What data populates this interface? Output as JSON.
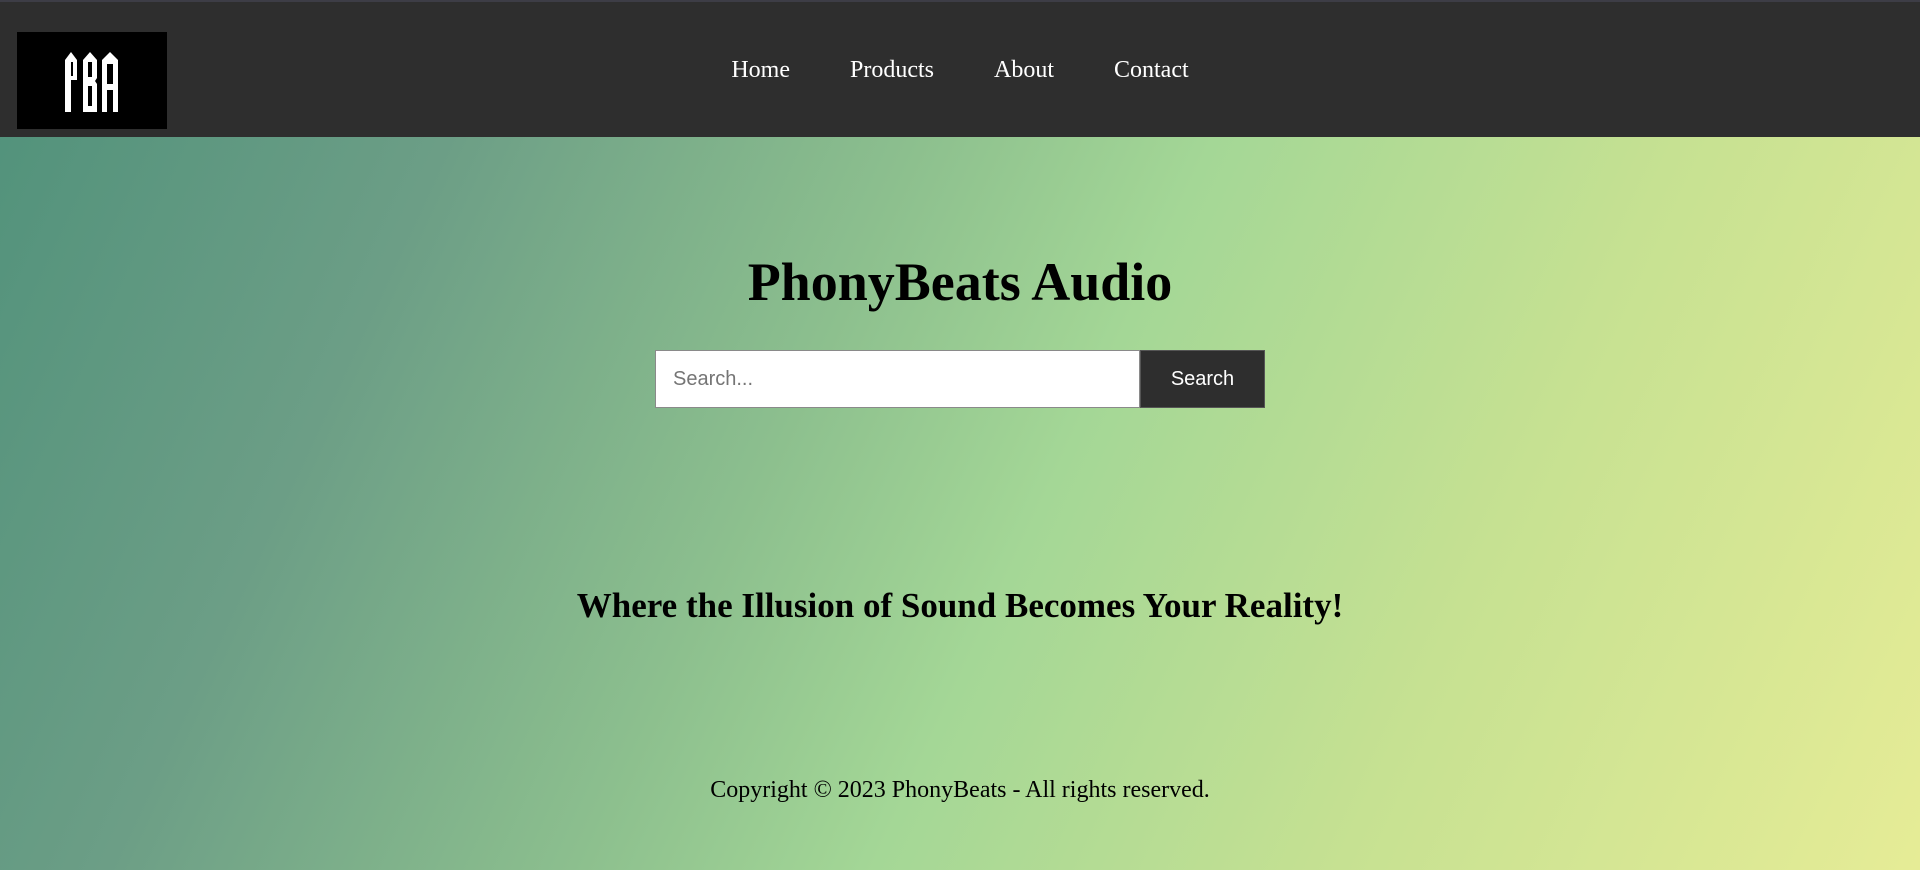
{
  "header": {
    "logo_text": "PBA",
    "nav": [
      {
        "label": "Home"
      },
      {
        "label": "Products"
      },
      {
        "label": "About"
      },
      {
        "label": "Contact"
      }
    ]
  },
  "hero": {
    "title": "PhonyBeats Audio",
    "search": {
      "placeholder": "Search...",
      "value": "",
      "button_label": "Search"
    },
    "tagline": "Where the Illusion of Sound Becomes Your Reality!"
  },
  "footer": {
    "copyright": "Copyright © 2023 PhonyBeats - All rights reserved."
  },
  "colors": {
    "header_bg": "#2e2e2e",
    "logo_bg": "#000000",
    "button_bg": "#2e2e2e",
    "gradient_start": "#4f917a",
    "gradient_mid": "#a4d796",
    "gradient_end": "#e6ec96"
  }
}
